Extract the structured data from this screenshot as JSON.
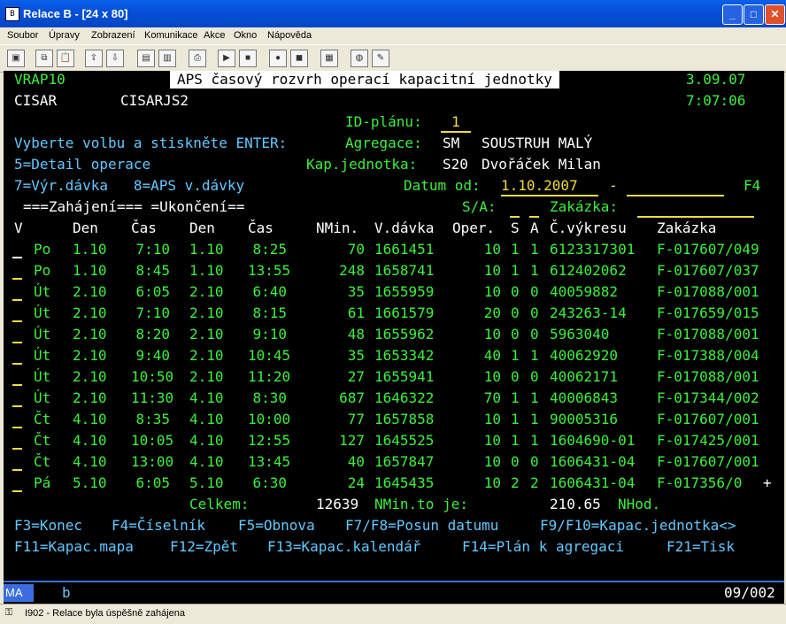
{
  "window": {
    "title": "Relace B - [24 x 80]"
  },
  "menu": [
    "Soubor",
    "Úpravy",
    "Zobrazení",
    "Komunikace",
    "Akce",
    "Okno",
    "Nápověda"
  ],
  "toolbar_icons": [
    "screen-icon",
    "copy-icon",
    "paste-icon",
    "send-icon",
    "receive-icon",
    "display-icon",
    "display2-icon",
    "print-icon",
    "macro-play-icon",
    "macro-stop-icon",
    "record-icon",
    "record-stop-icon",
    "clipboard-icon",
    "globe-icon",
    "edit-icon"
  ],
  "colors": {
    "green": "#3cf03c",
    "cyan": "#62c8ff",
    "yellow": "#f0dc3c",
    "white": "#ffffff"
  },
  "header": {
    "program": "VRAP10",
    "title": "APS časový rozvrh operací kapacitní jednotky",
    "date": "3.09.07",
    "user": "CISAR",
    "job": "CISARJS2",
    "time": "7:07:06"
  },
  "form": {
    "id_label": "ID-plánu:",
    "id_value": "1",
    "instruction": "Vyberte volbu a stiskněte ENTER:",
    "agg_label": "Agregace:",
    "agg_code": "SM",
    "agg_name": "SOUSTRUH MALÝ",
    "opt1": "5=Detail operace",
    "kap_label": "Kap.jednotka:",
    "kap_code": "S20",
    "kap_name": "Dvořáček Milan",
    "opt2": "7=Výr.dávka   8=APS v.dávky",
    "datum_label": "Datum od:",
    "datum_from": "1.10.2007",
    "datum_dash": "-",
    "datum_to": "",
    "f4": "F4",
    "groups": "===Zahájení=== =Ukončení==",
    "sa_label": "S/A:",
    "zak_label": "Zakázka:"
  },
  "columns": [
    "V",
    "Den",
    "Čas",
    "Den",
    "Čas",
    "NMin.",
    "V.dávka",
    "Oper.",
    "S",
    "A",
    "Č.výkresu",
    "Zakázka"
  ],
  "rows": [
    [
      "Po",
      "1.10",
      "7:10",
      "1.10",
      "8:25",
      "70",
      "1661451",
      "10",
      "1",
      "1",
      "6123317301",
      "F-017607/049"
    ],
    [
      "Po",
      "1.10",
      "8:45",
      "1.10",
      "13:55",
      "248",
      "1658741",
      "10",
      "1",
      "1",
      "612402062",
      "F-017607/037"
    ],
    [
      "Út",
      "2.10",
      "6:05",
      "2.10",
      "6:40",
      "35",
      "1655959",
      "10",
      "0",
      "0",
      "40059882",
      "F-017088/001"
    ],
    [
      "Út",
      "2.10",
      "7:10",
      "2.10",
      "8:15",
      "61",
      "1661579",
      "20",
      "0",
      "0",
      "243263-14",
      "F-017659/015"
    ],
    [
      "Út",
      "2.10",
      "8:20",
      "2.10",
      "9:10",
      "48",
      "1655962",
      "10",
      "0",
      "0",
      "5963040",
      "F-017088/001"
    ],
    [
      "Út",
      "2.10",
      "9:40",
      "2.10",
      "10:45",
      "35",
      "1653342",
      "40",
      "1",
      "1",
      "40062920",
      "F-017388/004"
    ],
    [
      "Út",
      "2.10",
      "10:50",
      "2.10",
      "11:20",
      "27",
      "1655941",
      "10",
      "0",
      "0",
      "40062171",
      "F-017088/001"
    ],
    [
      "Út",
      "2.10",
      "11:30",
      "4.10",
      "8:30",
      "687",
      "1646322",
      "70",
      "1",
      "1",
      "40006843",
      "F-017344/002"
    ],
    [
      "Čt",
      "4.10",
      "8:35",
      "4.10",
      "10:00",
      "77",
      "1657858",
      "10",
      "1",
      "1",
      "90005316",
      "F-017607/001"
    ],
    [
      "Čt",
      "4.10",
      "10:05",
      "4.10",
      "12:55",
      "127",
      "1645525",
      "10",
      "1",
      "1",
      "1604690-01",
      "F-017425/001"
    ],
    [
      "Čt",
      "4.10",
      "13:00",
      "4.10",
      "13:45",
      "40",
      "1657847",
      "10",
      "0",
      "0",
      "1606431-04",
      "F-017607/001"
    ],
    [
      "Pá",
      "5.10",
      "6:05",
      "5.10",
      "6:30",
      "24",
      "1645435",
      "10",
      "2",
      "2",
      "1606431-04",
      "F-017356/0"
    ]
  ],
  "more_indicator": "+",
  "totals": {
    "label": "Celkem:",
    "nmin": "12639",
    "to_label": "NMin.to je:",
    "hours": "210.65",
    "hours_unit": "NHod."
  },
  "fkeys": {
    "line1": [
      "F3=Konec",
      "F4=Číselník",
      "F5=Obnova",
      "F7/F8=Posun datumu",
      "F9/F10=Kapac.jednotka<>"
    ],
    "line2": [
      "F11=Kapac.mapa",
      "F12=Zpět",
      "F13=Kapac.kalendář",
      "F14=Plán k agregaci",
      "F21=Tisk"
    ]
  },
  "oia": {
    "mode": "MA",
    "field": "b",
    "cursor": "09/002"
  },
  "statusbar": {
    "message": "I902 - Relace byla úspěšně zahájena"
  }
}
